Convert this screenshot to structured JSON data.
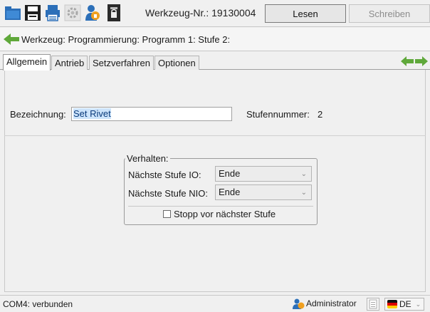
{
  "toolbar": {
    "tool_id": "Werkzeug-Nr.: 19130004",
    "read_label": "Lesen",
    "write_label": "Schreiben",
    "icons": [
      "open-folder-icon",
      "save-icon",
      "print-icon",
      "settings-gear-icon",
      "user-icon",
      "lock-icon"
    ]
  },
  "breadcrumb": {
    "text": "Werkzeug: Programmierung: Programm 1: Stufe 2:"
  },
  "tabs": [
    {
      "label": "Allgemein",
      "active": true
    },
    {
      "label": "Antrieb",
      "active": false
    },
    {
      "label": "Setzverfahren",
      "active": false
    },
    {
      "label": "Optionen",
      "active": false
    }
  ],
  "general": {
    "name_label": "Bezeichnung:",
    "name_value": "Set Rivet",
    "step_number_label": "Stufennummer:",
    "step_number_value": "2"
  },
  "behavior": {
    "title": "Verhalten:",
    "next_io_label": "Nächste Stufe IO:",
    "next_io_value": "Ende",
    "next_nio_label": "Nächste Stufe NIO:",
    "next_nio_value": "Ende",
    "stop_label": "Stopp vor nächster Stufe",
    "stop_checked": false
  },
  "status": {
    "connection": "COM4: verbunden",
    "user": "Administrator",
    "language": "DE"
  },
  "colors": {
    "arrow_green": "#5fa83a",
    "folder_blue": "#2c6fb8",
    "selection_bg": "#cde4fb"
  }
}
